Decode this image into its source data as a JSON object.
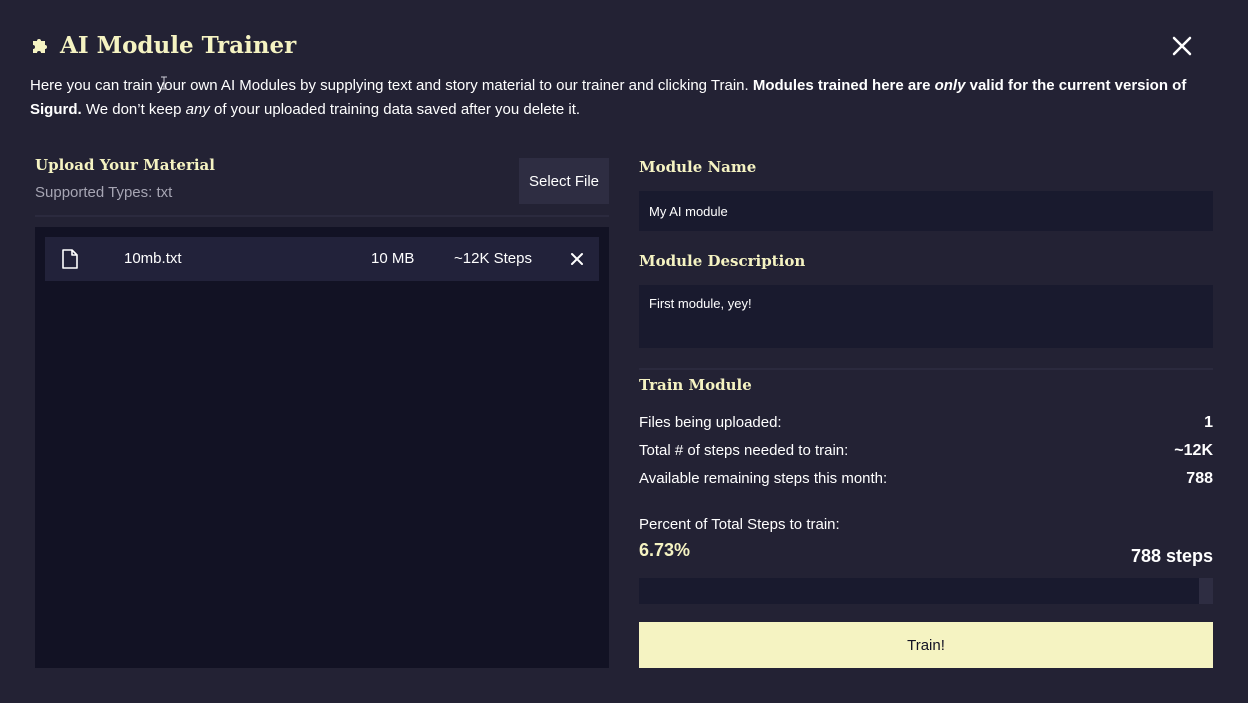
{
  "header": {
    "title": "AI Module Trainer",
    "icon": "puzzle-piece-icon",
    "close_icon": "close-icon"
  },
  "description": {
    "part1": "Here you can train your own AI Modules by supplying text and story material to our trainer and clicking Train. ",
    "bold1": "Modules trained here are ",
    "bold_italic": "only",
    "bold2": " valid for the current version of Sigurd.",
    "part2": " We don’t keep ",
    "italic": "any",
    "part3": " of your uploaded training data saved after you delete it."
  },
  "upload": {
    "title": "Upload Your Material",
    "types": "Supported Types: txt",
    "select_label": "Select File"
  },
  "files": [
    {
      "name": "10mb.txt",
      "size": "10 MB",
      "steps": "~12K Steps",
      "icon": "file-icon",
      "remove_icon": "close-icon"
    }
  ],
  "module": {
    "name_label": "Module Name",
    "name_value": "My AI module",
    "desc_label": "Module Description",
    "desc_value": "First module, yey!"
  },
  "train": {
    "title": "Train Module",
    "stats": [
      {
        "label": "Files being uploaded:",
        "value": "1"
      },
      {
        "label": "Total # of steps needed to train:",
        "value": "~12K"
      },
      {
        "label": "Available remaining steps this month:",
        "value": "788"
      }
    ],
    "percent_label": "Percent of Total Steps to train:",
    "percent_value": "6.73%",
    "steps_value": "788 steps",
    "progress_fraction": 0.0673,
    "button_label": "Train!"
  },
  "colors": {
    "background": "#232234",
    "accent": "#f5f3c2",
    "panel": "#121224",
    "input": "#191a2e"
  }
}
